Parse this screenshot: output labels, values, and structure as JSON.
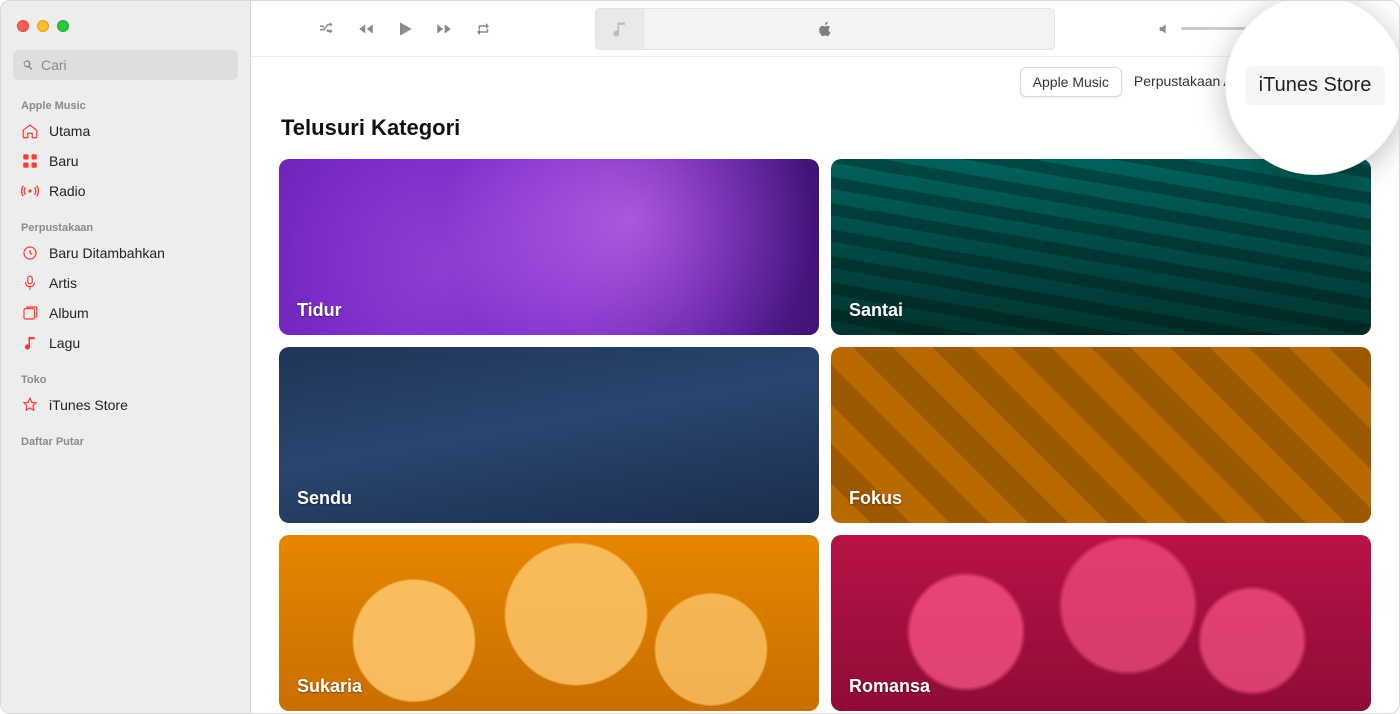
{
  "search": {
    "placeholder": "Cari"
  },
  "sidebar": {
    "sections": [
      {
        "label": "Apple Music",
        "items": [
          {
            "label": "Utama",
            "icon": "home-icon"
          },
          {
            "label": "Baru",
            "icon": "grid-icon"
          },
          {
            "label": "Radio",
            "icon": "radio-icon"
          }
        ]
      },
      {
        "label": "Perpustakaan",
        "items": [
          {
            "label": "Baru Ditambahkan",
            "icon": "clock-icon"
          },
          {
            "label": "Artis",
            "icon": "mic-icon"
          },
          {
            "label": "Album",
            "icon": "album-icon"
          },
          {
            "label": "Lagu",
            "icon": "note-icon"
          }
        ]
      },
      {
        "label": "Toko",
        "items": [
          {
            "label": "iTunes Store",
            "icon": "star-icon"
          }
        ]
      },
      {
        "label": "Daftar Putar",
        "items": []
      }
    ]
  },
  "tabs": [
    {
      "label": "Apple Music",
      "active": true
    },
    {
      "label": "Perpustakaan Anda",
      "active": false
    },
    {
      "label": "iTunes Store",
      "active": false
    }
  ],
  "page": {
    "title": "Telusuri Kategori"
  },
  "categories": [
    {
      "label": "Tidur",
      "style": "bg-tidur"
    },
    {
      "label": "Santai",
      "style": "bg-santai"
    },
    {
      "label": "Sendu",
      "style": "bg-sendu"
    },
    {
      "label": "Fokus",
      "style": "bg-fokus"
    },
    {
      "label": "Sukaria",
      "style": "bg-sukaria"
    },
    {
      "label": "Romansa",
      "style": "bg-romansa"
    }
  ],
  "callout": {
    "label": "iTunes Store"
  },
  "colors": {
    "accent": "#ff3b30"
  }
}
